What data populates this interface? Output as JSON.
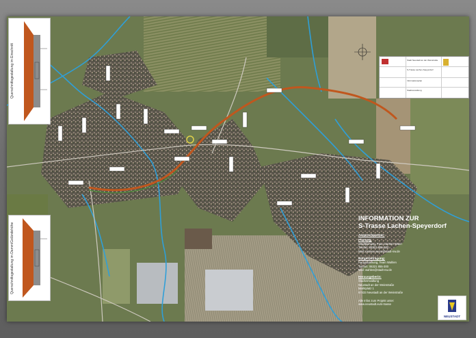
{
  "cross_sections": {
    "top_label": "Querschnittsgestaltung im Einschnitt",
    "bottom_label": "Querschnittsgestaltung im Damm/Geländehöhe"
  },
  "title_block": {
    "lines": [
      "Stadt Neustadt an der Weinstraße",
      "S-Trasse Lachen-Speyerdorf",
      "Informationsplan",
      "Stadtverwaltung"
    ]
  },
  "info": {
    "heading_line1": "INFORMATION ZUR",
    "heading_line2": "S-Trasse Lachen-Speyerdorf",
    "sections": [
      {
        "title": "Ansprechpartner:",
        "lines": []
      },
      {
        "title": "Planung:",
        "lines": [
          "Stadtplanung, Frau Carmen Wunn",
          "Telefon: 06321 855-533",
          "Mail: carmen.wunn@stadt-nw.de"
        ]
      },
      {
        "title": "Bürgerbefragung:",
        "lines": [
          "Hauptabteilung, Team Wahlen",
          "Telefon: 06321 855-300",
          "Mail: wahlen@stadt-nw.de"
        ]
      },
      {
        "title": "Herausgeberin:",
        "lines": [
          "Stadtverwaltung",
          "Neustadt an der Weinstraße",
          "Marktplatz 1",
          "67433 Neustadt an der Weinstraße"
        ]
      }
    ],
    "footer_line1": "Alle Infos zum Projekt unter:",
    "footer_line2": "www.neustadt.eu/s-trasse"
  },
  "logo": {
    "text": "NEUSTADT"
  },
  "colors": {
    "background": "#6f6f6f",
    "water": "#2f9fd8",
    "route": "#c0571e",
    "fields": "#7f8f5a",
    "settlement": "#57524a"
  }
}
